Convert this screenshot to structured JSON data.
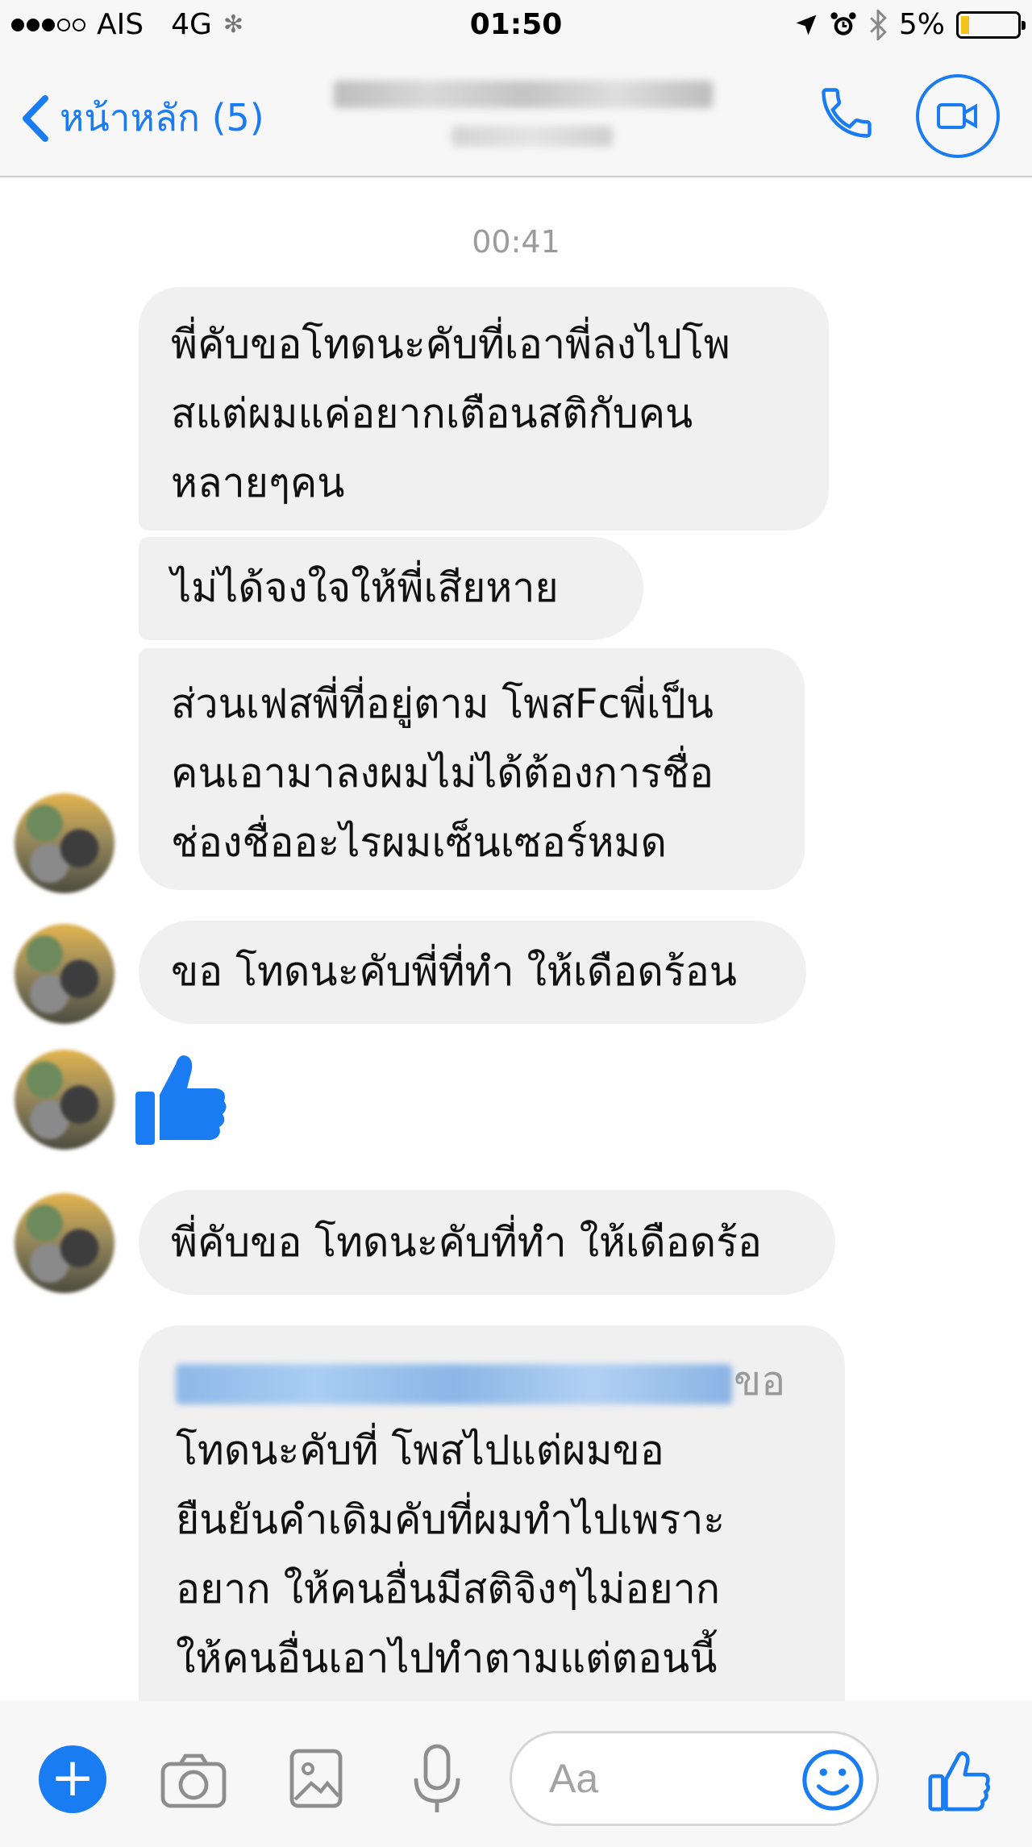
{
  "status_bar": {
    "carrier": "AIS",
    "network": "4G",
    "time": "01:50",
    "battery_percent_label": "5%",
    "battery_level": 0.05,
    "signal_strength_of_5": 3,
    "icons": [
      "location-arrow-icon",
      "alarm-icon",
      "bluetooth-icon"
    ]
  },
  "nav": {
    "back_label": "หน้าหลัก (5)",
    "call_icon": "phone-icon",
    "video_icon": "video-camera-icon"
  },
  "conversation": {
    "timestamp": "00:41",
    "messages": [
      {
        "line1": "พี่คับขอโทดนะคับที่เอาพี่ลงไปโพ",
        "line2": "สแต่ผมแค่อยากเตือนสติกับคน",
        "line3": "หลายๆคน"
      },
      {
        "line1": "ไม่ได้จงใจให้พี่เสียหาย"
      },
      {
        "line1": "ส่วนเฟสพี่ที่อยู่ตาม โพสFcพี่เป็น",
        "line2": "คนเอามาลงผมไม่ได้ต้องการชื่อ",
        "line3": "ช่องชื่ออะไรผมเซ็นเซอร์หมด"
      },
      {
        "line1": "ขอ โทดนะคับพี่ที่ทำ ให้เดือดร้อน"
      },
      {
        "sticker": "thumbs-up-icon"
      },
      {
        "line1": "พี่คับขอ โทดนะคับที่ทำ ให้เดือดร้อ"
      },
      {
        "line1_suffix": "ขอ",
        "line2": "โทดนะคับที่ โพสไปแต่ผมขอ",
        "line3": "ยืนยันคำเดิมคับที่ผมทำไปเพราะ",
        "line4": "อยาก ให้คนอื่นมีสติจิงๆไม่อยาก",
        "line5": "ให้คนอื่นเอาไปทำตามแต่ตอนนี้"
      }
    ]
  },
  "composer": {
    "placeholder": "Aa",
    "icons": [
      "plus-icon",
      "camera-icon",
      "image-icon",
      "microphone-icon",
      "emoji-icon",
      "thumbs-up-icon"
    ],
    "accent_color": "#1a7cf2",
    "bubble_color": "#f1f0f0"
  }
}
